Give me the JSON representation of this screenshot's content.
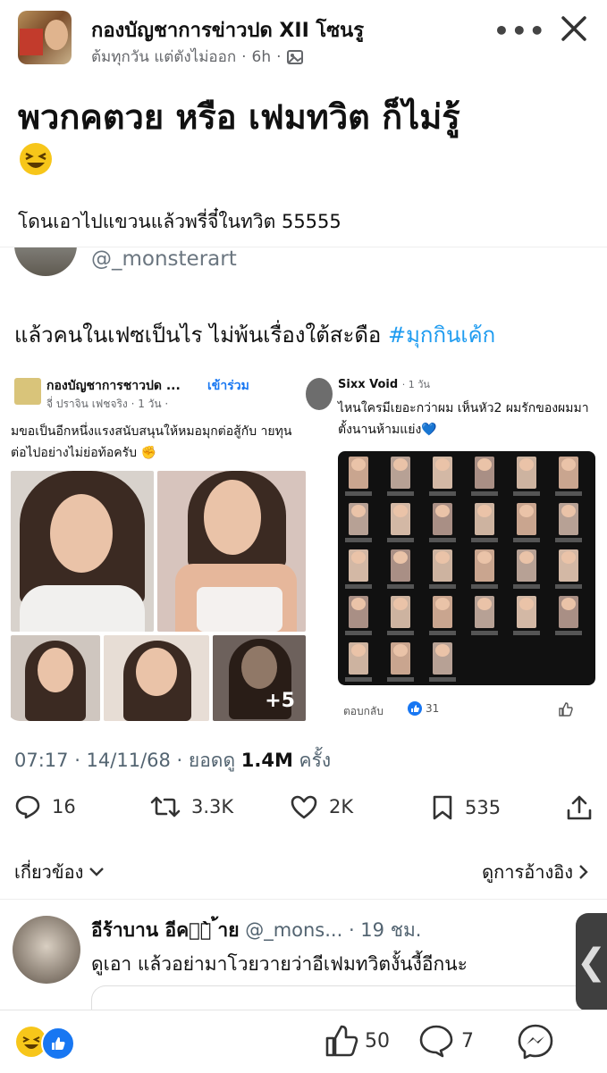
{
  "header": {
    "page_name": "กองบัญชาการข่าวปด XII โซนรู",
    "author": "ต้มทุกวัน แต่ตังไม่ออก",
    "time": "6h",
    "post_title": "พวกคตวย หรือ เฟมทวิต ก็ไม่รู้",
    "emoji": "😆",
    "caption": "โดนเอาไปแขวนแล้วพรี่จี๋ในทวิต 55555"
  },
  "tweet": {
    "handle": "@_monsterart",
    "text": "แล้วคนในเฟซเป็นไร ไม่พ้นเรื่องใต้สะดือ ",
    "hashtag": "#มุกกินเค้ก",
    "left_card": {
      "group_name": "กองบัญชาการชาวปด ...",
      "join_label": "เข้าร่วม",
      "meta": "จี่ ปราจิน เฟชจริง · 1 วัน ·",
      "text": "มขอเป็นอีกหนึ่งแรงสนับสนุนให้หมอมุกต่อสู้กับ ายทุนต่อไปอย่างไม่ย่อท้อครับ ✊",
      "more_photos": "+5"
    },
    "right_card": {
      "name": "Sixx Void",
      "time": "· 1 วัน",
      "text": "ไหนใครมีเยอะกว่าผม เห็นหัว2 ผมรักของผมมา ตั้งนานห้ามแย่ง💙",
      "reply_label": "ตอบกลับ",
      "reaction_count": "31"
    },
    "timestamp_prefix": "07:17 · 14/11/68 · ยอดดู ",
    "views": "1.4M",
    "views_suffix": " ครั้ง",
    "stats": {
      "replies": "16",
      "retweets": "3.3K",
      "likes": "2K",
      "bookmarks": "535"
    },
    "related_label": "เกี่ยวข้อง",
    "quotes_label": "ดูการอ้างอิง"
  },
  "reply": {
    "name": "อีร้าบาน อีคว้̀̀̀̀̀̀̀̀̀̀̀̀̀̀̀̀ ้าย",
    "handle_time": " @_mons... · 19 ชม.",
    "text": "ดูเอา แล้วอย่ามาโวยวายว่าอีเฟมทวิตงั้นงี้อีกนะ",
    "side_tab": "❮"
  },
  "footer": {
    "likes": "50",
    "comments": "7"
  },
  "colors": {
    "link": "#1d9bf0",
    "fb_blue": "#1877f2",
    "muted": "#536471"
  }
}
